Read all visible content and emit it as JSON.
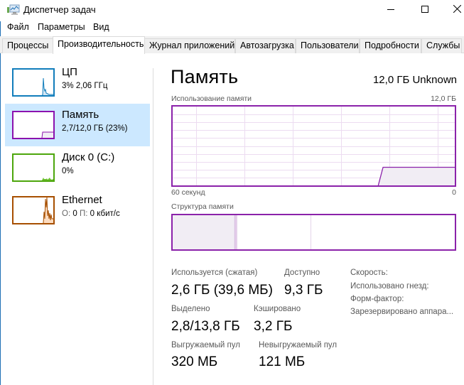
{
  "window": {
    "title": "Диспетчер задач",
    "icon": "task-manager-icon",
    "controls": {
      "minimize": "minimize-icon",
      "maximize": "maximize-icon",
      "close": "close-icon"
    }
  },
  "menu": [
    "Файл",
    "Параметры",
    "Вид"
  ],
  "tabs": [
    {
      "label": "Процессы",
      "active": false
    },
    {
      "label": "Производительность",
      "active": true
    },
    {
      "label": "Журнал приложений",
      "active": false
    },
    {
      "label": "Автозагрузка",
      "active": false
    },
    {
      "label": "Пользователи",
      "active": false
    },
    {
      "label": "Подробности",
      "active": false
    },
    {
      "label": "Службы",
      "active": false
    }
  ],
  "sidebar": {
    "items": [
      {
        "title": "ЦП",
        "subtitle": "3% 2,06 ГГц",
        "color": "#117dbb",
        "selected": false
      },
      {
        "title": "Память",
        "subtitle": "2,7/12,0 ГБ (23%)",
        "color": "#8b12ae",
        "selected": true
      },
      {
        "title": "Диск 0 (C:)",
        "subtitle": "0%",
        "color": "#4da60c",
        "selected": false
      },
      {
        "title": "Ethernet",
        "subtitle_send_label": "О:",
        "subtitle_send": "0",
        "subtitle_recv_label": "П:",
        "subtitle_recv": "0 кбит/с",
        "color": "#a74f01",
        "selected": false
      }
    ]
  },
  "main": {
    "title": "Память",
    "total": "12,0 ГБ Unknown",
    "usage_graph": {
      "label": "Использование памяти",
      "max_label": "12,0 ГБ",
      "x_left_label": "60 секунд",
      "x_right_label": "0",
      "accent": "#8b22aa",
      "fill": "#f1edf4",
      "grid": "#ecdcf1",
      "history_fraction": [
        0,
        0,
        0,
        0,
        0,
        0,
        0,
        0,
        0,
        0,
        0,
        0,
        0,
        0,
        0,
        0,
        0,
        0,
        0,
        0,
        0,
        0,
        0,
        0,
        0,
        0,
        0,
        0,
        0,
        0,
        0,
        0,
        0,
        0,
        0,
        0,
        0,
        0,
        0,
        0,
        0,
        0,
        0,
        0,
        0.23,
        0.23,
        0.23,
        0.23,
        0.23,
        0.23,
        0.23,
        0.23,
        0.23,
        0.23,
        0.23,
        0.23,
        0.23,
        0.23,
        0.23,
        0.23
      ]
    },
    "structure": {
      "label": "Структура памяти",
      "segments_fraction": [
        {
          "name": "in-use",
          "fraction": 0.22,
          "fill": "#f1edf4"
        },
        {
          "name": "modified",
          "fraction": 0.008,
          "fill": "#e4cdea"
        },
        {
          "name": "standby",
          "fraction": 0.262,
          "fill": "#ffffff"
        },
        {
          "name": "free",
          "fraction": 0.51,
          "fill": "#ffffff"
        }
      ]
    },
    "stats": {
      "in_use_label": "Используется (сжатая)",
      "in_use_value": "2,6 ГБ (39,6 МБ)",
      "available_label": "Доступно",
      "available_value": "9,3 ГБ",
      "committed_label": "Выделено",
      "committed_value": "2,8/13,8 ГБ",
      "cached_label": "Кэшировано",
      "cached_value": "3,2 ГБ",
      "paged_label": "Выгружаемый пул",
      "paged_value": "320 МБ",
      "nonpaged_label": "Невыгружаемый пул",
      "nonpaged_value": "121 МБ"
    },
    "info": [
      "Скорость:",
      "Использовано гнезд:",
      "Форм-фактор:",
      "Зарезервировано аппара..."
    ]
  }
}
